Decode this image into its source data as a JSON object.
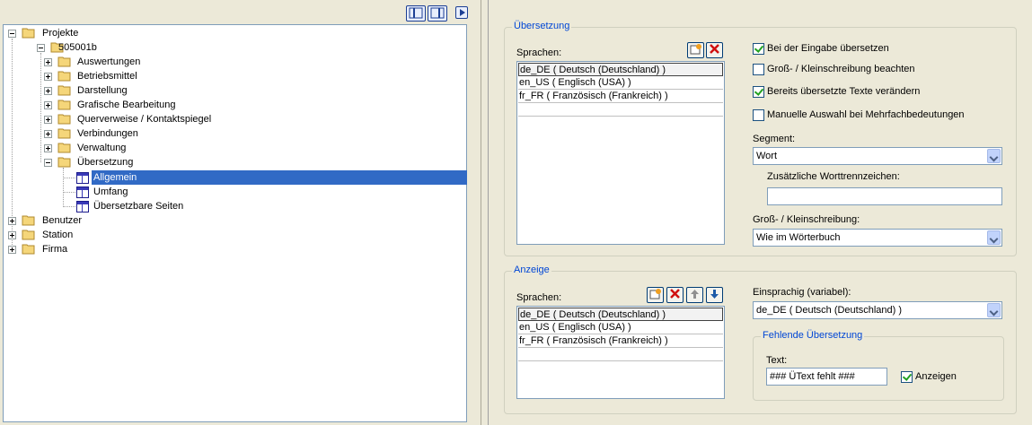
{
  "tree": {
    "nodes": [
      {
        "label": "Projekte"
      },
      {
        "label": "505001b"
      },
      {
        "label": "Auswertungen"
      },
      {
        "label": "Betriebsmittel"
      },
      {
        "label": "Darstellung"
      },
      {
        "label": "Grafische Bearbeitung"
      },
      {
        "label": "Querverweise / Kontaktspiegel"
      },
      {
        "label": "Verbindungen"
      },
      {
        "label": "Verwaltung"
      },
      {
        "label": "Übersetzung"
      },
      {
        "label": "Allgemein"
      },
      {
        "label": "Umfang"
      },
      {
        "label": "Übersetzbare Seiten"
      },
      {
        "label": "Benutzer"
      },
      {
        "label": "Station"
      },
      {
        "label": "Firma"
      }
    ],
    "selected": "Allgemein"
  },
  "translation": {
    "group_title": "Übersetzung",
    "languages_label": "Sprachen:",
    "languages": [
      "de_DE ( Deutsch (Deutschland) )",
      "en_US ( Englisch (USA) )",
      "fr_FR ( Französisch (Frankreich) )"
    ],
    "options": [
      {
        "label": "Bei der Eingabe übersetzen",
        "checked": true
      },
      {
        "label": "Groß- / Kleinschreibung beachten",
        "checked": false
      },
      {
        "label": "Bereits übersetzte Texte verändern",
        "checked": true
      },
      {
        "label": "Manuelle Auswahl bei Mehrfachbedeutungen",
        "checked": false
      }
    ],
    "segment_label": "Segment:",
    "segment_value": "Wort",
    "extra_separators_label": "Zusätzliche Worttrennzeichen:",
    "extra_separators_value": "",
    "case_label": "Groß- / Kleinschreibung:",
    "case_value": "Wie im Wörterbuch"
  },
  "display": {
    "group_title": "Anzeige",
    "languages_label": "Sprachen:",
    "languages": [
      "de_DE ( Deutsch (Deutschland) )",
      "en_US ( Englisch (USA) )",
      "fr_FR ( Französisch (Frankreich) )"
    ],
    "monolingual_label": "Einsprachig (variabel):",
    "monolingual_value": "de_DE ( Deutsch (Deutschland) )",
    "missing_group_title": "Fehlende Übersetzung",
    "text_label": "Text:",
    "text_value": "### ÜText fehlt ###",
    "show_label": "Anzeigen",
    "show_checked": true
  },
  "colors": {
    "selection": "#316ac5",
    "group_title": "#0046d5",
    "check": "#21a121"
  }
}
